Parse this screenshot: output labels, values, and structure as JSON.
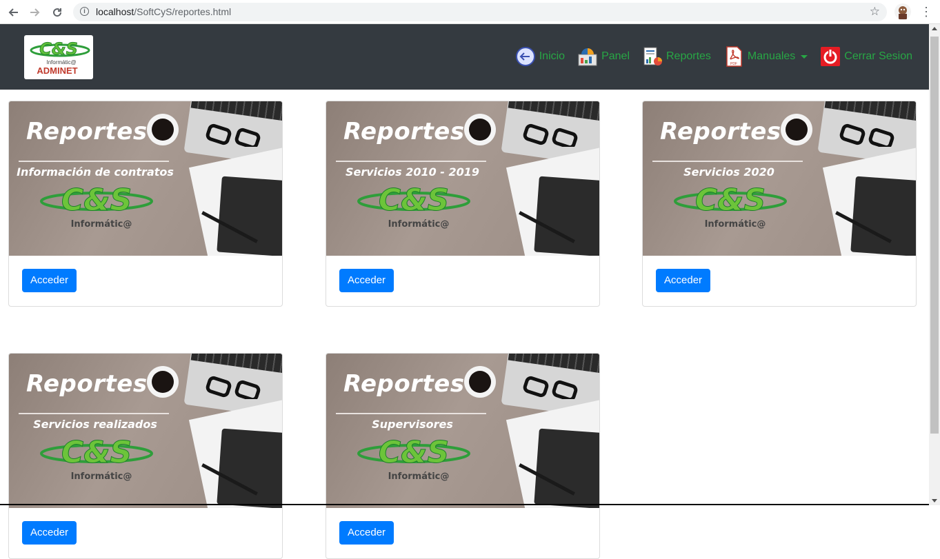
{
  "browser": {
    "url_host": "localhost",
    "url_path": "/SoftCyS/reportes.html",
    "back_icon": "arrow-left-icon",
    "forward_icon": "arrow-right-icon",
    "reload_icon": "reload-icon"
  },
  "navbar": {
    "logo_text": "C&S",
    "logo_sub": "Informátic@",
    "logo_name": "ADMINET",
    "items": [
      {
        "label": "Inicio",
        "icon": "back-arrow-circle-icon"
      },
      {
        "label": "Panel",
        "icon": "dashboard-icon"
      },
      {
        "label": "Reportes",
        "icon": "report-chart-icon"
      },
      {
        "label": "Manuales",
        "icon": "pdf-icon"
      },
      {
        "label": "Cerrar Sesion",
        "icon": "power-icon"
      }
    ],
    "colors": {
      "bg": "#343a40",
      "link": "#28a745"
    }
  },
  "cards": [
    {
      "title": "Reportes",
      "subtitle": "Información de contratos",
      "brand": "Informátic@",
      "button": "Acceder"
    },
    {
      "title": "Reportes",
      "subtitle": "Servicios 2010 - 2019",
      "brand": "Informátic@",
      "button": "Acceder"
    },
    {
      "title": "Reportes",
      "subtitle": "Servicios 2020",
      "brand": "Informátic@",
      "button": "Acceder"
    },
    {
      "title": "Reportes",
      "subtitle": "Servicios realizados",
      "brand": "Informátic@",
      "button": "Acceder"
    },
    {
      "title": "Reportes",
      "subtitle": "Supervisores",
      "brand": "Informátic@",
      "button": "Acceder"
    }
  ],
  "accent": "#007bff"
}
